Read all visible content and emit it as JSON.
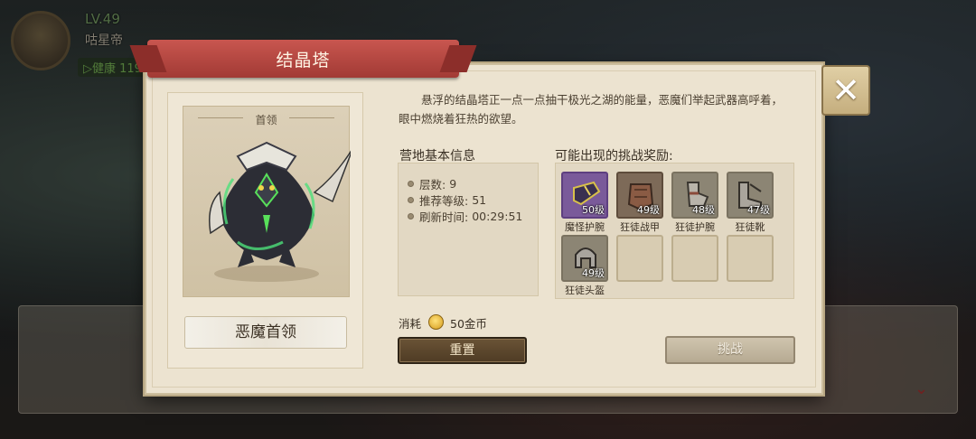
{
  "background": {
    "player_level": "LV.49",
    "player_name": "咕星帝",
    "player_status": "▷健康 119"
  },
  "dialog": {
    "title": "结晶塔",
    "close_icon": "close-icon"
  },
  "boss": {
    "caption": "首领",
    "name": "恶魔首领"
  },
  "description": "悬浮的结晶塔正一点一点抽干极光之湖的能量，恶魔们举起武器高呼着，眼中燃烧着狂热的欲望。",
  "camp_info": {
    "title": "营地基本信息",
    "rows": [
      {
        "label": "层数:",
        "value": "9"
      },
      {
        "label": "推荐等级:",
        "value": "51"
      },
      {
        "label": "刷新时间:",
        "value": "00:29:51"
      }
    ]
  },
  "rewards": {
    "title": "可能出现的挑战奖励:",
    "items": [
      {
        "name": "魔怪护腕",
        "level": "50级",
        "icon": "bracer-icon",
        "rarity_color": "#7a5a9a"
      },
      {
        "name": "狂徒战甲",
        "level": "49级",
        "icon": "armor-icon",
        "rarity_color": "#7d6a58"
      },
      {
        "name": "狂徒护腕",
        "level": "48级",
        "icon": "gauntlet-icon",
        "rarity_color": "#8c8574"
      },
      {
        "name": "狂徒靴",
        "level": "47级",
        "icon": "boots-icon",
        "rarity_color": "#8c8574"
      },
      {
        "name": "狂徒头盔",
        "level": "49级",
        "icon": "helmet-icon",
        "rarity_color": "#8c8574"
      }
    ]
  },
  "cost": {
    "label": "消耗",
    "value": "50金币",
    "icon": "gold-coin-icon"
  },
  "buttons": {
    "reset": "重置",
    "challenge": "挑战"
  }
}
